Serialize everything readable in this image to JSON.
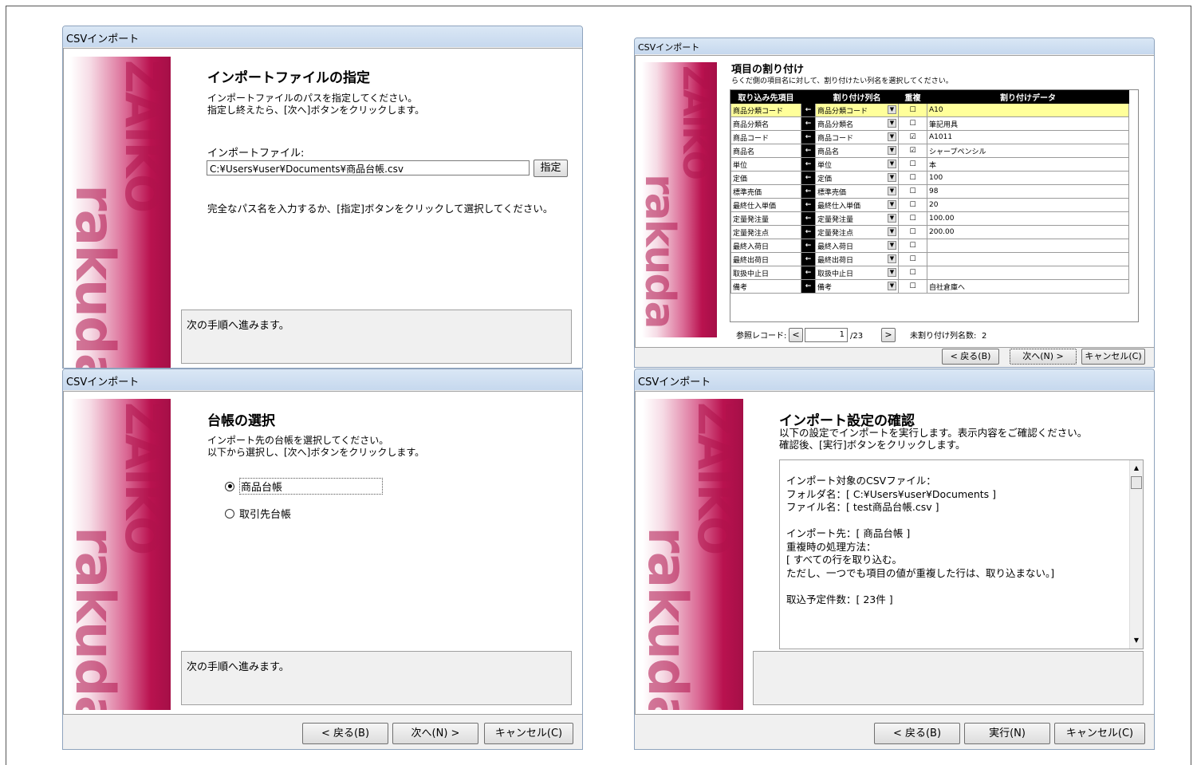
{
  "brand": {
    "word1": "ZAIKO",
    "word2": "rakuda"
  },
  "d1": {
    "title": "CSVインポート",
    "heading": "インポートファイルの指定",
    "desc1": "インポートファイルのパスを指定してください。",
    "desc2": "指定し終えたら、[次へ]ボタンをクリックします。",
    "file_label": "インポートファイル:",
    "file_value": "C:¥Users¥user¥Documents¥商品台帳.csv",
    "browse_label": "指定",
    "hint": "完全なパス名を入力するか、[指定]ボタンをクリックして選択してください。",
    "message": "次の手順へ進みます。"
  },
  "d2": {
    "title": "CSVインポート",
    "heading": "項目の割り付け",
    "desc": "らくだ側の項目名に対して、割り付けたい列名を選択してください。",
    "columns": [
      "取り込み先項目",
      "割り付け列名",
      "重複",
      "割り付けデータ"
    ],
    "rows": [
      {
        "target": "商品分類コード",
        "source": "商品分類コード",
        "dup": "☐",
        "data": "A10"
      },
      {
        "target": "商品分類名",
        "source": "商品分類名",
        "dup": "☐",
        "data": "筆記用具"
      },
      {
        "target": "商品コード",
        "source": "商品コード",
        "dup": "☑",
        "data": "A1011"
      },
      {
        "target": "商品名",
        "source": "商品名",
        "dup": "☑",
        "data": "シャープペンシル"
      },
      {
        "target": "単位",
        "source": "単位",
        "dup": "☐",
        "data": "本"
      },
      {
        "target": "定価",
        "source": "定価",
        "dup": "☐",
        "data": "100"
      },
      {
        "target": "標準売価",
        "source": "標準売価",
        "dup": "☐",
        "data": "98"
      },
      {
        "target": "最終仕入単価",
        "source": "最終仕入単価",
        "dup": "☐",
        "data": "20"
      },
      {
        "target": "定量発注量",
        "source": "定量発注量",
        "dup": "☐",
        "data": "100.00"
      },
      {
        "target": "定量発注点",
        "source": "定量発注点",
        "dup": "☐",
        "data": "200.00"
      },
      {
        "target": "最終入荷日",
        "source": "最終入荷日",
        "dup": "☐",
        "data": ""
      },
      {
        "target": "最終出荷日",
        "source": "最終出荷日",
        "dup": "☐",
        "data": ""
      },
      {
        "target": "取扱中止日",
        "source": "取扱中止日",
        "dup": "☐",
        "data": ""
      },
      {
        "target": "備考",
        "source": "備考",
        "dup": "☐",
        "data": "自社倉庫へ"
      }
    ],
    "arrow": "←",
    "ref_label": "参照レコード:",
    "prev": "<",
    "record": "1",
    "total": "/23",
    "next": ">",
    "unassigned_label": "未割り付け列名数:",
    "unassigned_count": "2",
    "back": "< 戻る(B)",
    "next_btn": "次へ(N) >",
    "cancel": "キャンセル(C)"
  },
  "d3": {
    "title": "CSVインポート",
    "heading": "台帳の選択",
    "desc1": "インポート先の台帳を選択してください。",
    "desc2": "以下から選択し、[次へ]ボタンをクリックします。",
    "option1": "商品台帳",
    "option2": "取引先台帳",
    "message": "次の手順へ進みます。",
    "back": "< 戻る(B)",
    "next": "次へ(N) >",
    "cancel": "キャンセル(C)"
  },
  "d4": {
    "title": "CSVインポート",
    "heading": "インポート設定の確認",
    "desc1": "以下の設定でインポートを実行します。表示内容をご確認ください。",
    "desc2": "確認後、[実行]ボタンをクリックします。",
    "lines": [
      "インポート対象のCSVファイル：",
      "フォルダ名：[ C:¥Users¥user¥Documents ]",
      "ファイル名：[ test商品台帳.csv ]",
      "",
      "インポート先：[ 商品台帳 ]",
      "重複時の処理方法：",
      "[ すべての行を取り込む。",
      "ただし、一つでも項目の値が重複した行は、取り込まない。]",
      "",
      "取込予定件数：[ 23件 ]"
    ],
    "back": "< 戻る(B)",
    "run": "実行(N)",
    "cancel": "キャンセル(C)"
  }
}
